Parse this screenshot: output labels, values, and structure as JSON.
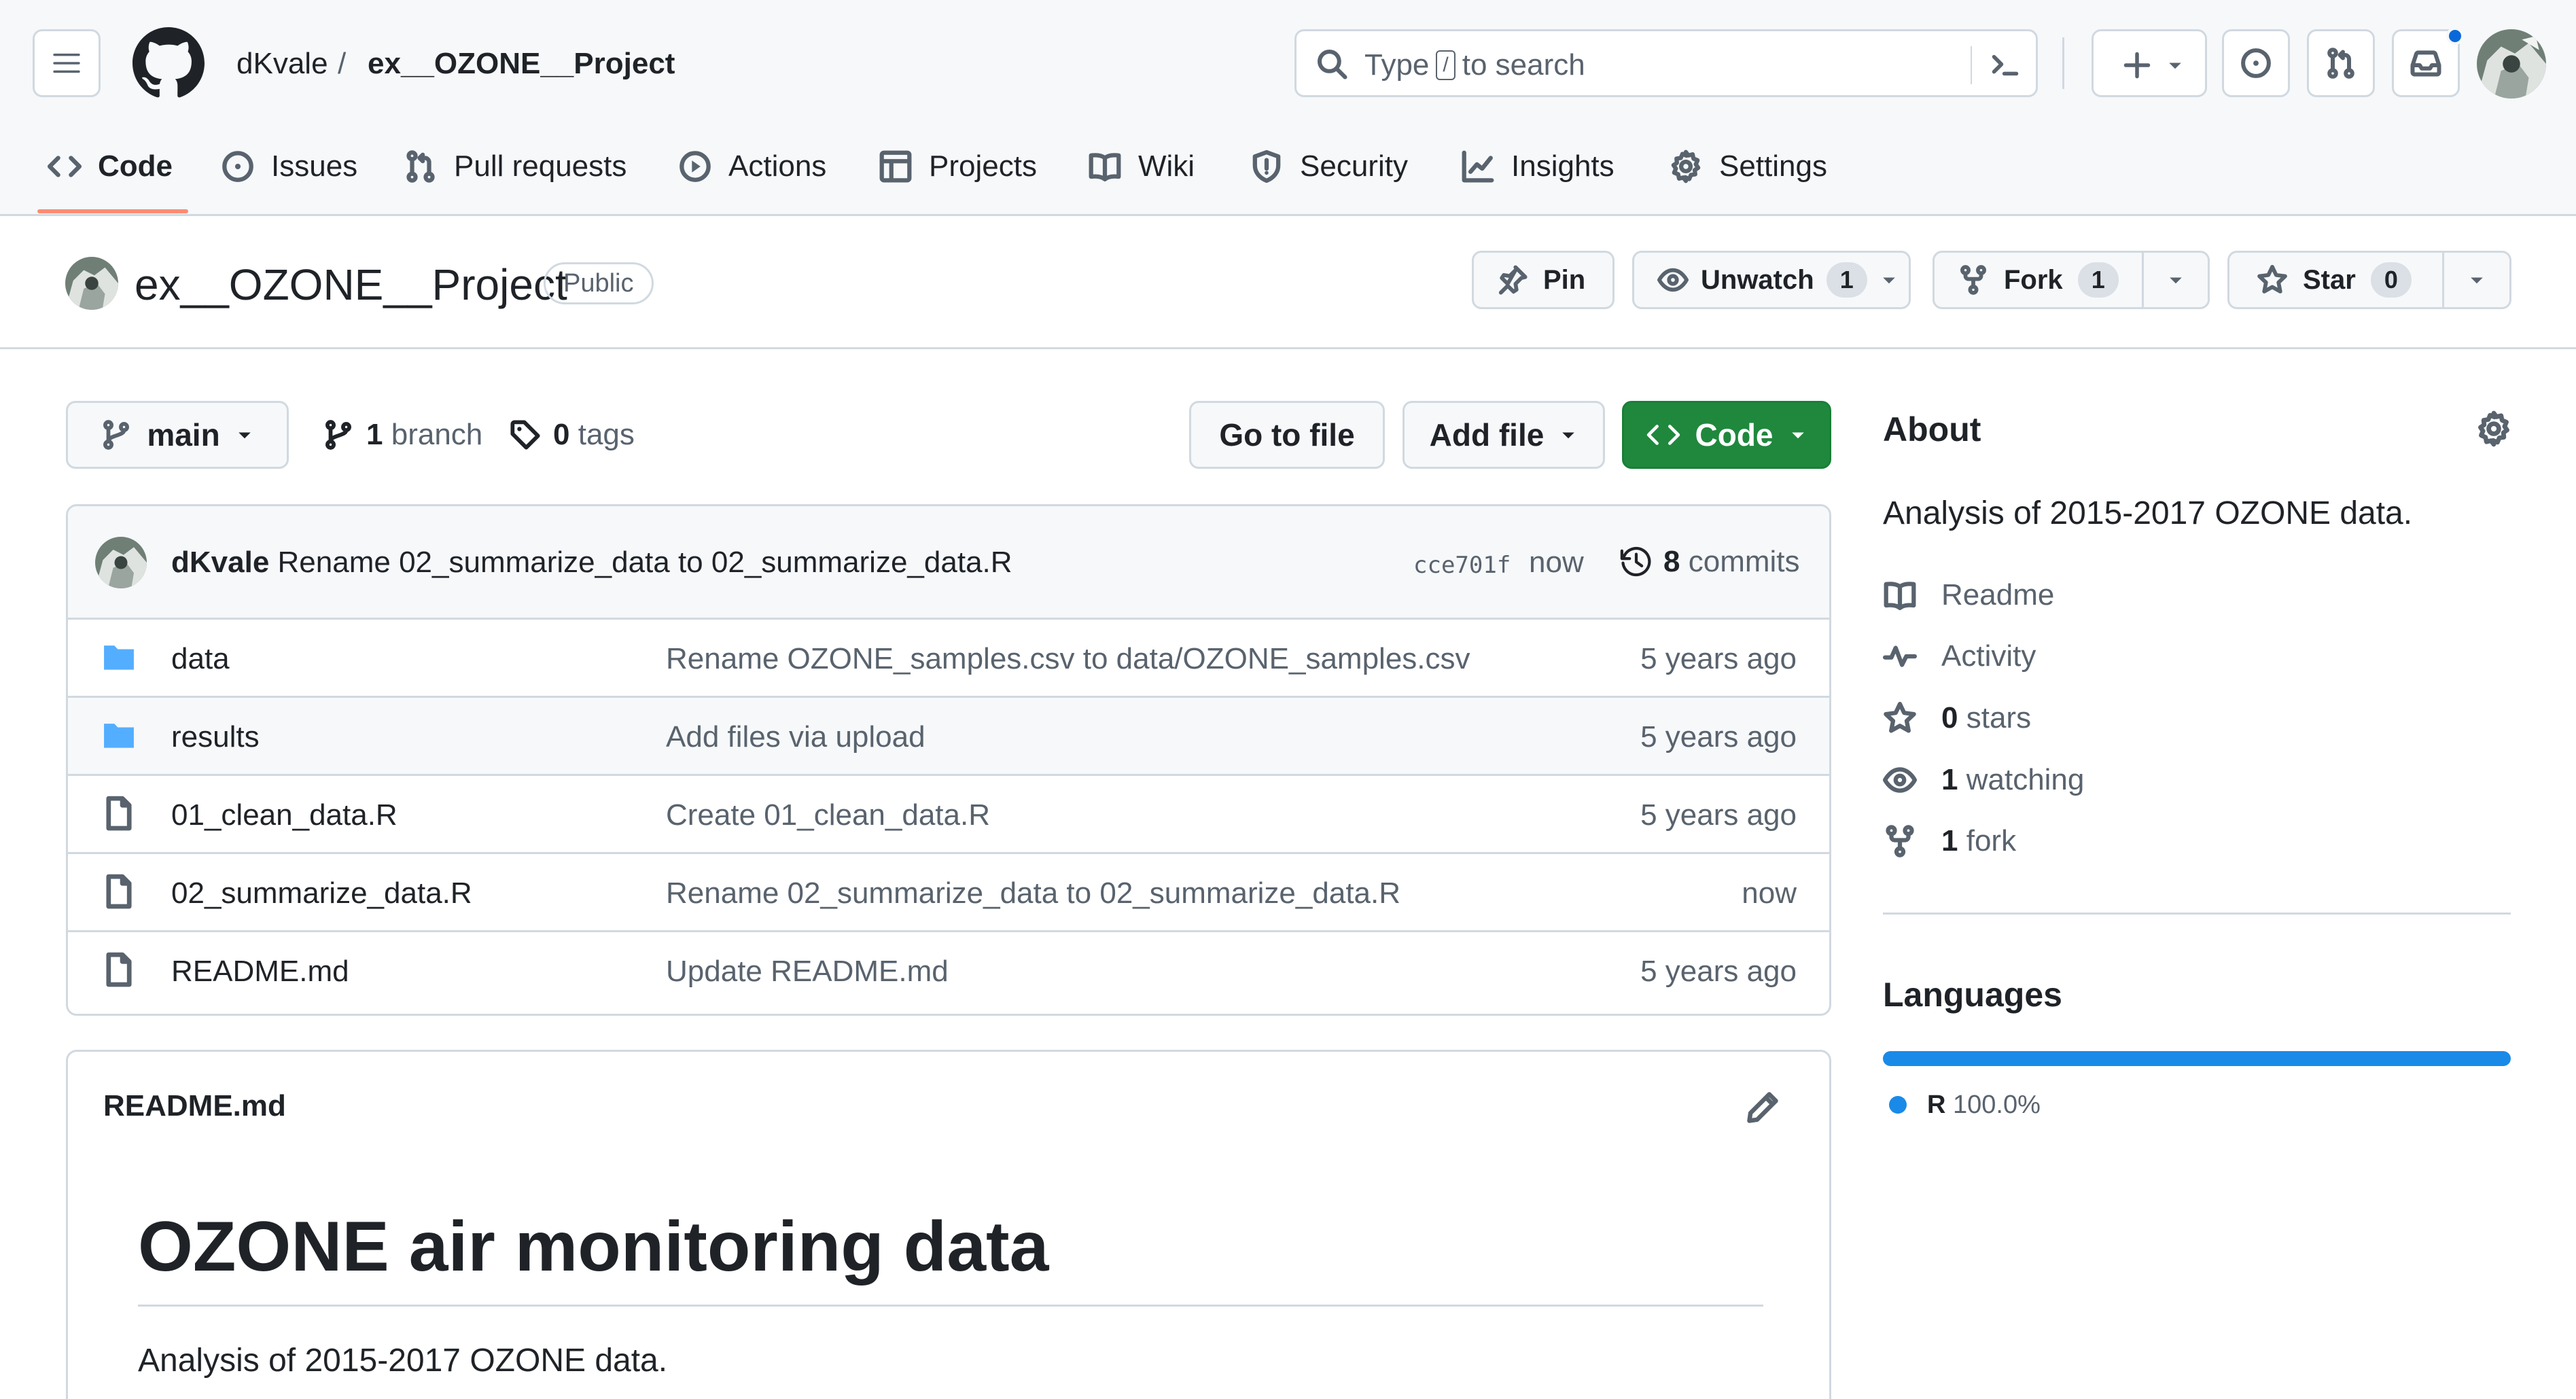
{
  "header": {
    "owner": "dKvale",
    "separator": "/",
    "repo": "ex__OZONE__Project",
    "search": {
      "prefix": "Type",
      "key": "/",
      "suffix": "to search"
    },
    "has_notification": true
  },
  "tabs": [
    {
      "label": "Code",
      "icon": "code-icon",
      "selected": true
    },
    {
      "label": "Issues",
      "icon": "issue-opened-icon"
    },
    {
      "label": "Pull requests",
      "icon": "git-pull-request-icon"
    },
    {
      "label": "Actions",
      "icon": "play-icon"
    },
    {
      "label": "Projects",
      "icon": "table-icon"
    },
    {
      "label": "Wiki",
      "icon": "book-icon"
    },
    {
      "label": "Security",
      "icon": "shield-icon"
    },
    {
      "label": "Insights",
      "icon": "graph-icon"
    },
    {
      "label": "Settings",
      "icon": "gear-icon"
    }
  ],
  "repo": {
    "name": "ex__OZONE__Project",
    "visibility": "Public",
    "pin_label": "Pin",
    "watch_label": "Unwatch",
    "watch_count": "1",
    "fork_label": "Fork",
    "fork_count": "1",
    "star_label": "Star",
    "star_count": "0"
  },
  "filenav": {
    "branch": "main",
    "branch_count": "1",
    "branch_word": "branch",
    "tag_count": "0",
    "tag_word": "tags",
    "go_to_file": "Go to file",
    "add_file": "Add file",
    "code": "Code"
  },
  "latest_commit": {
    "author": "dKvale",
    "message": "Rename 02_summarize_data to 02_summarize_data.R",
    "hash": "cce701f",
    "time": "now",
    "commit_count": "8",
    "commit_word": "commits"
  },
  "files": [
    {
      "name": "data",
      "type": "folder",
      "message": "Rename OZONE_samples.csv to data/OZONE_samples.csv",
      "time": "5 years ago"
    },
    {
      "name": "results",
      "type": "folder",
      "message": "Add files via upload",
      "time": "5 years ago"
    },
    {
      "name": "01_clean_data.R",
      "type": "file",
      "message": "Create 01_clean_data.R",
      "time": "5 years ago"
    },
    {
      "name": "02_summarize_data.R",
      "type": "file",
      "message": "Rename 02_summarize_data to 02_summarize_data.R",
      "time": "now"
    },
    {
      "name": "README.md",
      "type": "file",
      "message": "Update README.md",
      "time": "5 years ago"
    }
  ],
  "readme": {
    "filename": "README.md",
    "heading": "OZONE air monitoring data",
    "body": "Analysis of 2015-2017 OZONE data."
  },
  "about": {
    "title": "About",
    "description": "Analysis of 2015-2017 OZONE data.",
    "readme": "Readme",
    "activity": "Activity",
    "stars_count": "0",
    "stars_word": "stars",
    "watching_count": "1",
    "watching_word": "watching",
    "forks_count": "1",
    "forks_word": "fork"
  },
  "languages": {
    "title": "Languages",
    "items": [
      {
        "name": "R",
        "percent": "100.0%",
        "fraction": 1.0,
        "color": "#198ae8"
      }
    ]
  },
  "colors": {
    "accent": "#0969da",
    "code_button": "#1f883d",
    "tab_underline": "#fd8c73",
    "folder": "#54aeff"
  }
}
